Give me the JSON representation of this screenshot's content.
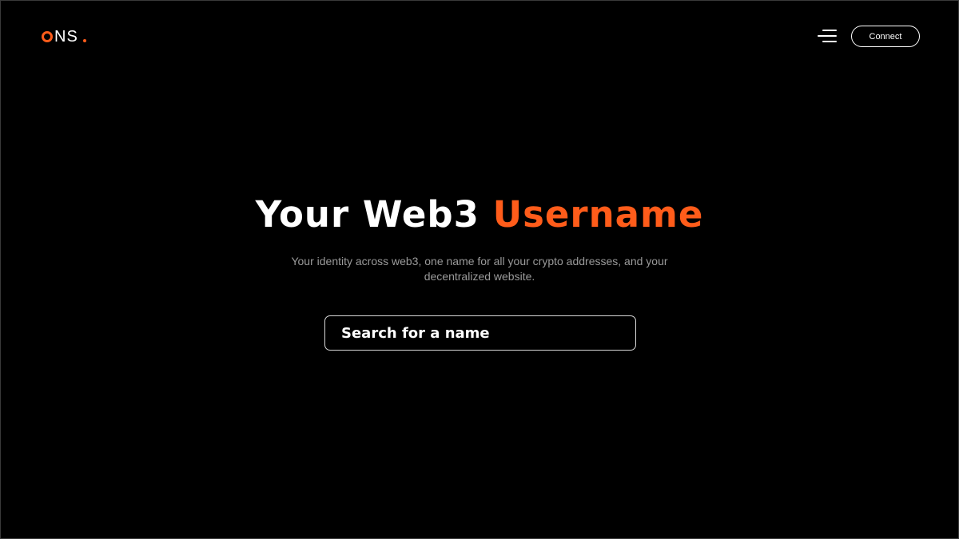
{
  "header": {
    "logo_text": "NS",
    "connect_label": "Connect",
    "menu_icon": "hamburger-menu-icon"
  },
  "hero": {
    "title_white": "Your Web3",
    "title_accent": "Username",
    "subtitle": "Your identity across web3, one name for all your crypto addresses, and your decentralized website."
  },
  "search": {
    "placeholder": "Search for a name",
    "value": ""
  },
  "colors": {
    "accent": "#ff5c1a",
    "background": "#000000",
    "text": "#ffffff",
    "muted": "#9a9a9a"
  }
}
